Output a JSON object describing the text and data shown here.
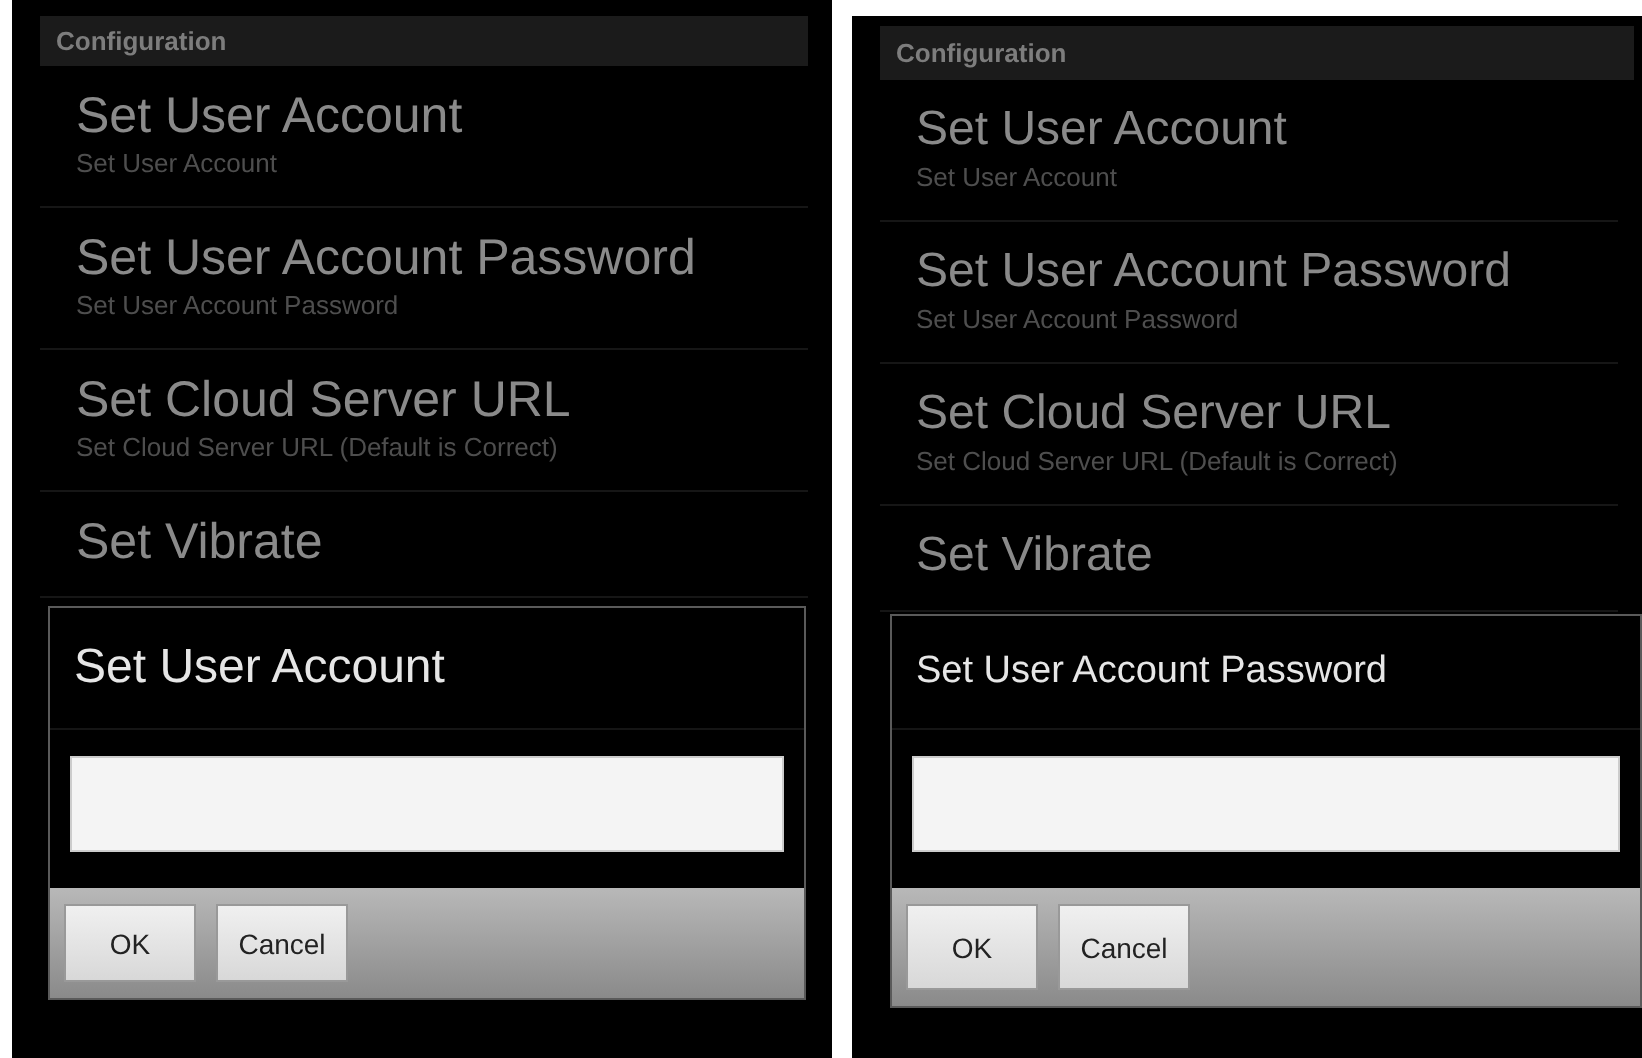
{
  "screens": [
    {
      "header": "Configuration",
      "items": [
        {
          "title": "Set User Account",
          "subtitle": "Set User Account"
        },
        {
          "title": "Set User Account Password",
          "subtitle": "Set User Account Password"
        },
        {
          "title": "Set Cloud Server URL",
          "subtitle": "Set Cloud Server URL (Default is Correct)"
        },
        {
          "title": "Set Vibrate"
        }
      ],
      "dialog": {
        "title": "Set User Account",
        "buttons": [
          "OK",
          "Cancel"
        ]
      }
    },
    {
      "header": "Configuration",
      "items": [
        {
          "title": "Set User Account",
          "subtitle": "Set User Account"
        },
        {
          "title": "Set User Account Password",
          "subtitle": "Set User Account Password"
        },
        {
          "title": "Set Cloud Server URL",
          "subtitle": "Set Cloud Server URL (Default is Correct)"
        },
        {
          "title": "Set Vibrate"
        }
      ],
      "dialog": {
        "title": "Set User Account Password",
        "buttons": [
          "OK",
          "Cancel"
        ]
      }
    }
  ]
}
